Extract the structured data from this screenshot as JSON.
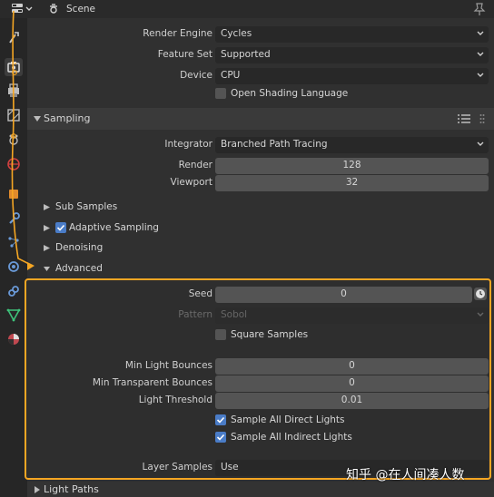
{
  "header": {
    "title": "Scene"
  },
  "sidebar": {
    "tabs": [
      "tool",
      "render",
      "output",
      "view-layer",
      "scene",
      "world",
      "object",
      "modifiers",
      "particles",
      "physics",
      "constraints",
      "data",
      "material"
    ]
  },
  "render": {
    "engine_label": "Render Engine",
    "engine_value": "Cycles",
    "feature_label": "Feature Set",
    "feature_value": "Supported",
    "device_label": "Device",
    "device_value": "CPU",
    "osl_label": "Open Shading Language"
  },
  "sampling": {
    "title": "Sampling",
    "integrator_label": "Integrator",
    "integrator_value": "Branched Path Tracing",
    "render_label": "Render",
    "render_value": "128",
    "viewport_label": "Viewport",
    "viewport_value": "32",
    "sub_samples": "Sub Samples",
    "adaptive_sampling": "Adaptive Sampling",
    "denoising": "Denoising",
    "advanced": "Advanced"
  },
  "advanced": {
    "seed_label": "Seed",
    "seed_value": "0",
    "pattern_label": "Pattern",
    "pattern_value": "Sobol",
    "square_samples": "Square Samples",
    "min_light_label": "Min Light Bounces",
    "min_light_value": "0",
    "min_transparent_label": "Min Transparent Bounces",
    "min_transparent_value": "0",
    "light_threshold_label": "Light Threshold",
    "light_threshold_value": "0.01",
    "sample_direct": "Sample All Direct Lights",
    "sample_indirect": "Sample All Indirect Lights",
    "layer_samples_label": "Layer Samples",
    "layer_samples_value": "Use"
  },
  "light_paths": {
    "title": "Light Paths"
  },
  "watermark": "知乎 @在人间凑人数",
  "colors": {
    "highlight": "#f5a623",
    "checkbox": "#4a7cc7"
  }
}
